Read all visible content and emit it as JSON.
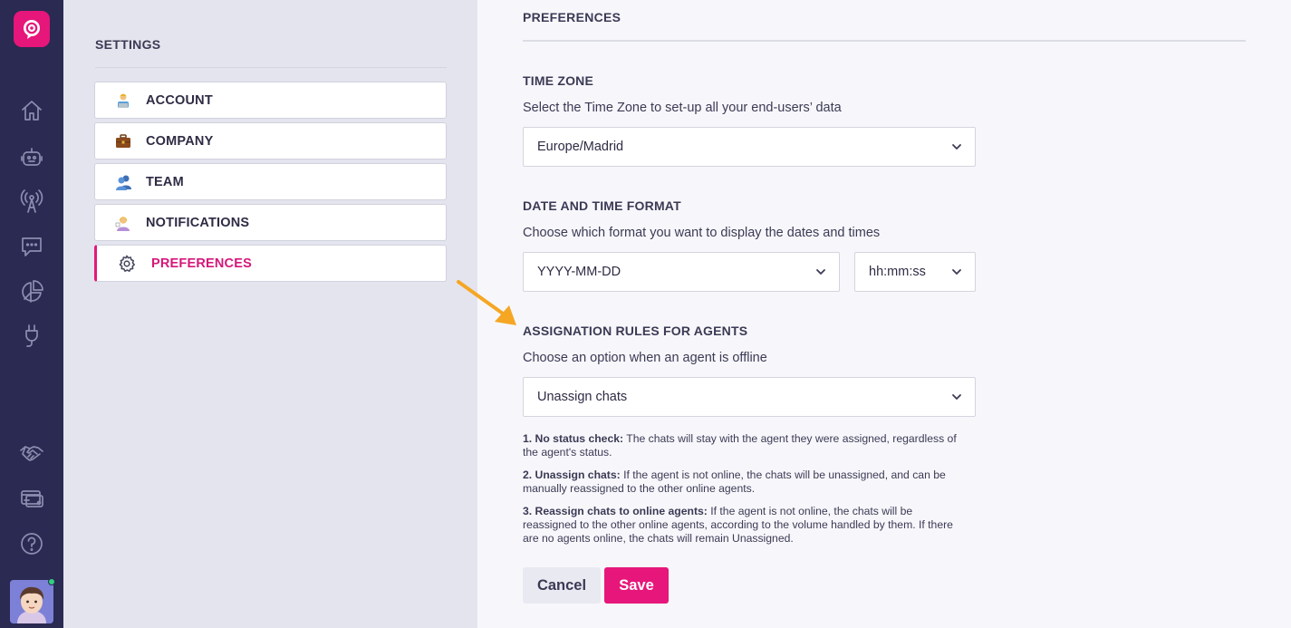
{
  "sidebar": {
    "rail_icons": [
      "home-icon",
      "bot-icon",
      "broadcast-icon",
      "chat-icon",
      "analytics-icon",
      "integrations-icon",
      "handshake-icon",
      "billing-icon",
      "help-icon"
    ]
  },
  "settings": {
    "title": "SETTINGS",
    "items": [
      {
        "label": "ACCOUNT",
        "icon": "account-icon"
      },
      {
        "label": "COMPANY",
        "icon": "company-icon"
      },
      {
        "label": "TEAM",
        "icon": "team-icon"
      },
      {
        "label": "NOTIFICATIONS",
        "icon": "notifications-icon"
      },
      {
        "label": "PREFERENCES",
        "icon": "gear-icon",
        "active": true
      }
    ]
  },
  "main": {
    "title": "PREFERENCES",
    "timezone": {
      "title": "TIME ZONE",
      "description": "Select the Time Zone to set-up all your end-users’ data",
      "value": "Europe/Madrid"
    },
    "datetime": {
      "title": "DATE AND TIME FORMAT",
      "description": "Choose which format you want to display the dates and times",
      "date_value": "YYYY-MM-DD",
      "time_value": "hh:mm:ss"
    },
    "assignation": {
      "title": "ASSIGNATION RULES FOR AGENTS",
      "description": "Choose an option when an agent is offline",
      "value": "Unassign chats",
      "rules": [
        {
          "label": "1. No status check:",
          "text": " The chats will stay with the agent they were assigned, regardless of the agent's status."
        },
        {
          "label": "2. Unassign chats:",
          "text": " If the agent is not online, the chats will be unassigned, and can be manually reassigned to the other online agents."
        },
        {
          "label": "3. Reassign chats to online agents:",
          "text": " If the agent is not online, the chats will be reassigned to the other online agents, according to the volume handled by them. If there are no agents online, the chats will remain Unassigned."
        }
      ]
    },
    "buttons": {
      "cancel": "Cancel",
      "save": "Save"
    }
  },
  "colors": {
    "accent": "#e6167a",
    "rail": "#2a2a52",
    "annotation_arrow": "#f5a623"
  }
}
